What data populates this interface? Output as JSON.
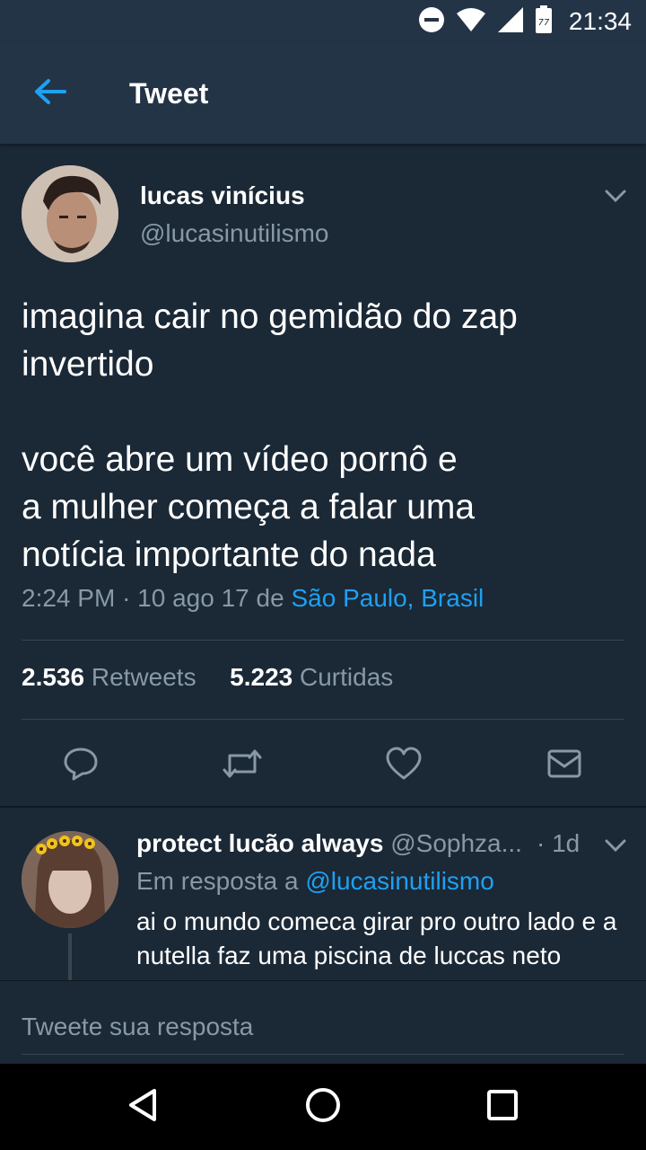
{
  "status_bar": {
    "time": "21:34",
    "battery_level": "77",
    "icons": [
      "do-not-disturb-icon",
      "wifi-icon",
      "signal-icon",
      "battery-icon"
    ]
  },
  "header": {
    "back_icon": "arrow-left-icon",
    "title": "Tweet"
  },
  "tweet": {
    "author_name": "lucas vinícius",
    "author_handle": "@lucasinutilismo",
    "text": "imagina cair no gemidão do zap\ninvertido\n\nvocê abre um vídeo pornô e\na mulher começa a falar uma\nnotícia importante do nada",
    "time": "2:24 PM",
    "date": "10 ago 17",
    "location_prefix": "de",
    "location": "São Paulo, Brasil",
    "retweets_count": "2.536",
    "retweets_label": "Retweets",
    "likes_count": "5.223",
    "likes_label": "Curtidas",
    "actions": [
      "reply-icon",
      "retweet-icon",
      "like-icon",
      "message-icon"
    ]
  },
  "reply": {
    "author_name": "protect lucão always",
    "author_handle": "@Sophza...",
    "time": "· 1d",
    "reply_to_label": "Em resposta a",
    "reply_to_handle": "@lucasinutilismo",
    "text": "ai o mundo comeca girar pro outro lado e a nutella faz uma piscina de luccas neto"
  },
  "composer": {
    "placeholder": "Tweete sua resposta"
  },
  "nav": {
    "icons": [
      "back-triangle-icon",
      "home-circle-icon",
      "recents-square-icon"
    ]
  },
  "colors": {
    "background": "#1b2836",
    "bar": "#243447",
    "accent": "#1da1f2",
    "secondary_text": "#8899a6"
  }
}
